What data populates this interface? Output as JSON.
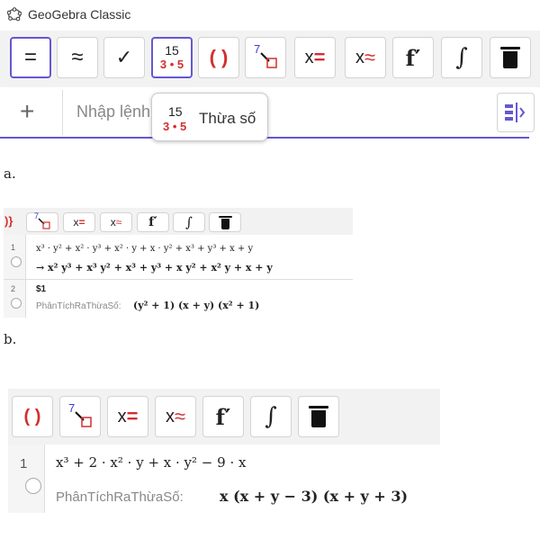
{
  "app": {
    "title": "GeoGebra Classic"
  },
  "toolbar_a": {
    "tools": [
      {
        "name": "evaluate-tool",
        "label": "="
      },
      {
        "name": "numeric-tool",
        "label": "≈"
      },
      {
        "name": "keep-input-tool",
        "label": "✓"
      },
      {
        "name": "factor-tool",
        "top": "15",
        "bottom": "3 • 5"
      },
      {
        "name": "expand-tool",
        "label": "( )"
      },
      {
        "name": "substitute-tool",
        "label": "7"
      },
      {
        "name": "solve-tool",
        "x": "x",
        "eq": "="
      },
      {
        "name": "solve-numeric-tool",
        "x": "x",
        "eq": "≈"
      },
      {
        "name": "derivative-tool",
        "label": "f′"
      },
      {
        "name": "integral-tool",
        "label": "∫"
      },
      {
        "name": "delete-tool",
        "label": ""
      }
    ]
  },
  "input_bar": {
    "plus": "+",
    "placeholder": "Nhập lệnh"
  },
  "tooltip": {
    "top": "15",
    "bottom": "3 • 5",
    "label": "Thừa số"
  },
  "labels": {
    "a": "a.",
    "b": "b."
  },
  "toolbar_b": {
    "paren": ")}",
    "sub": "7",
    "x1": "x",
    "eq1": "=",
    "x2": "x",
    "eq2": "≈",
    "deriv": "f′",
    "int": "∫"
  },
  "panel_b": {
    "row1_num": "1",
    "row1_input": "x³ · y² + x² · y³ + x² · y + x · y² + x³ + y³ + x + y",
    "row1_output": "→  x² y³ + x³ y² + x³ + y³ + x y² + x² y + x + y",
    "row2_num": "2",
    "row2_input": "$1",
    "row2_label": "PhânTíchRaThừaSố:",
    "row2_result": "(y² + 1)  (x + y)  (x² + 1)"
  },
  "toolbar_c": {
    "paren": "( )",
    "sub": "7",
    "x1": "x",
    "eq1": "=",
    "x2": "x",
    "eq2": "≈",
    "deriv": "f′",
    "int": "∫"
  },
  "panel_c": {
    "row_num": "1",
    "input": "x³ + 2 · x² · y + x · y² − 9 · x",
    "label": "PhânTíchRaThừaSố:",
    "result": "x  (x + y − 3)  (x + y + 3)"
  }
}
